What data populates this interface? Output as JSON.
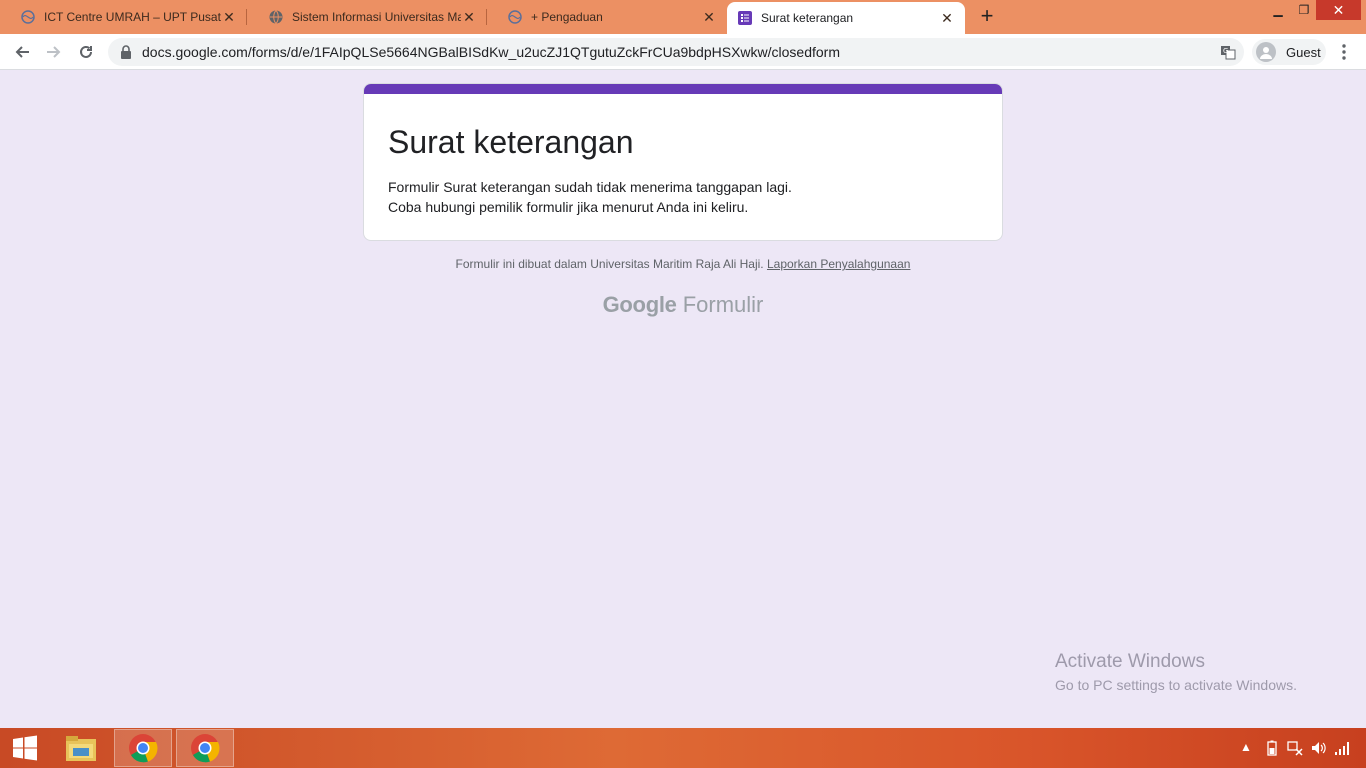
{
  "browser": {
    "tabs": [
      {
        "title": "ICT Centre UMRAH – UPT Pusat T",
        "active": false
      },
      {
        "title": "Sistem Informasi Universitas Mar",
        "active": false
      },
      {
        "title": "+ Pengaduan",
        "active": false
      },
      {
        "title": "Surat keterangan",
        "active": true
      }
    ],
    "new_tab_label": "+",
    "url": "docs.google.com/forms/d/e/1FAIpQLSe5664NGBalBISdKw_u2ucZJ1QTgutuZckFrCUa9bdpHSXwkw/closedform",
    "profile_label": "Guest"
  },
  "form": {
    "title": "Surat keterangan",
    "message_line1": "Formulir Surat keterangan sudah tidak menerima tanggapan lagi.",
    "message_line2": "Coba hubungi pemilik formulir jika menurut Anda ini keliru.",
    "footer_text": "Formulir ini dibuat dalam Universitas Maritim Raja Ali Haji.",
    "report_link": "Laporkan Penyalahgunaan",
    "brand_google": "Google",
    "brand_product": "Formulir",
    "accent_color": "#673ab7"
  },
  "watermark": {
    "line1": "Activate Windows",
    "line2": "Go to PC settings to activate Windows."
  },
  "taskbar": {
    "items": [
      "start-icon",
      "file-explorer-icon",
      "chrome-icon",
      "chrome-icon"
    ]
  }
}
